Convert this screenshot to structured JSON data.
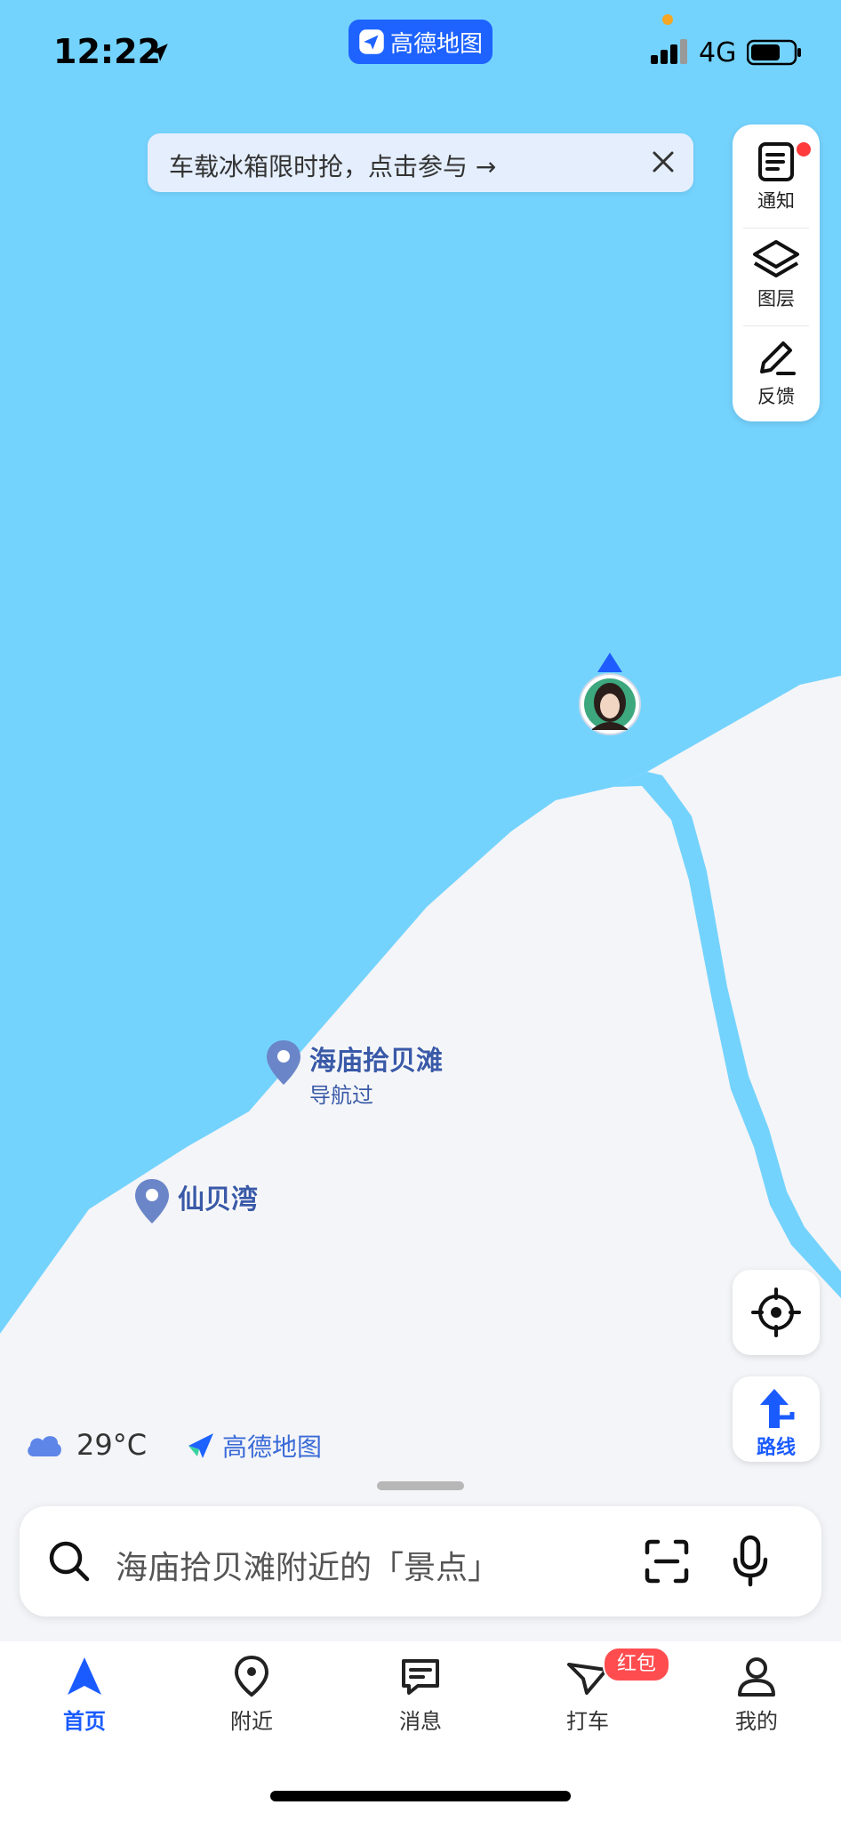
{
  "status_bar": {
    "time": "12:22",
    "network": "4G",
    "app_badge": "高德地图"
  },
  "banner": {
    "text": "车载冰箱限时抢，点击参与 →"
  },
  "side_panel": [
    {
      "label": "通知",
      "icon": "notification-icon"
    },
    {
      "label": "图层",
      "icon": "layers-icon"
    },
    {
      "label": "反馈",
      "icon": "feedback-edit-icon"
    }
  ],
  "map": {
    "pois": [
      {
        "name": "海庙拾贝滩",
        "sub": "导航过"
      },
      {
        "name": "仙贝湾",
        "sub": ""
      }
    ],
    "colors": {
      "water": "#74d3fd",
      "land": "#f4f5f8"
    }
  },
  "route_button": {
    "label": "路线"
  },
  "weather": {
    "temp": "29°C",
    "icon": "cloud-icon"
  },
  "map_logo": "高德地图",
  "search": {
    "placeholder": "海庙拾贝滩附近的「景点」"
  },
  "tabs": [
    {
      "label": "首页",
      "icon": "navigation-arrow-icon",
      "active": true
    },
    {
      "label": "附近",
      "icon": "location-pin-icon",
      "active": false
    },
    {
      "label": "消息",
      "icon": "message-icon",
      "active": false
    },
    {
      "label": "打车",
      "icon": "taxi-icon",
      "active": false
    },
    {
      "label": "我的",
      "icon": "profile-icon",
      "active": false
    }
  ],
  "taxi_badge": "红包",
  "accent_color": "#1a5bff"
}
